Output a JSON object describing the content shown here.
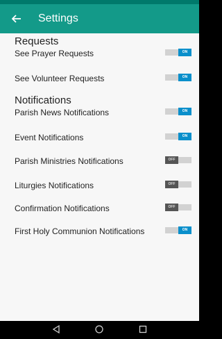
{
  "app_bar": {
    "title": "Settings",
    "back_icon": "arrow-left-icon"
  },
  "sections": {
    "requests": {
      "title": "Requests",
      "items": [
        {
          "label": "See Prayer Requests",
          "state": "ON"
        },
        {
          "label": "See Volunteer Requests",
          "state": "ON"
        }
      ]
    },
    "notifications": {
      "title": "Notifications",
      "items": [
        {
          "label": "Parish News Notifications",
          "state": "ON"
        },
        {
          "label": "Event Notifications",
          "state": "ON"
        },
        {
          "label": "Parish Ministries Notifications",
          "state": "OFF"
        },
        {
          "label": "Liturgies Notifications",
          "state": "OFF"
        },
        {
          "label": "Confirmation Notifications",
          "state": "OFF"
        },
        {
          "label": "First Holy Communion Notifications",
          "state": "ON"
        }
      ]
    }
  },
  "nav": {
    "back": "back-triangle-icon",
    "home": "home-circle-icon",
    "recents": "recents-square-icon"
  },
  "colors": {
    "app_bar": "#139a89",
    "toggle_on": "#0a8fcb",
    "toggle_off": "#555555"
  }
}
